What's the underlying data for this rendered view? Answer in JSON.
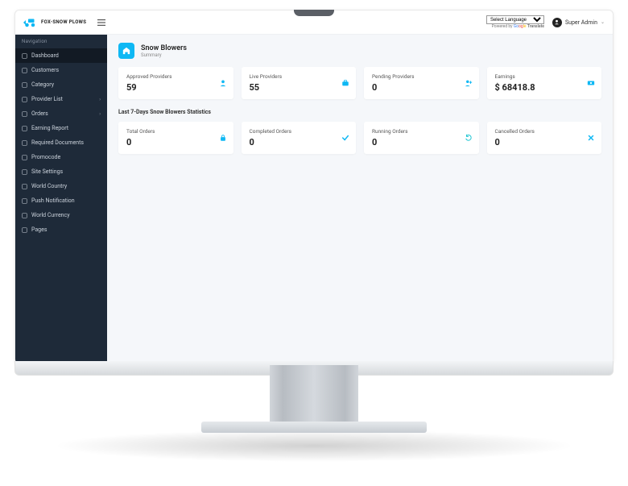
{
  "brand": {
    "name": "FOX-SNOW PLOWS"
  },
  "topbar": {
    "language_label": "Select Language",
    "powered_by": "Powered by",
    "google": "Google",
    "translate": "Translate",
    "user_name": "Super Admin"
  },
  "sidebar": {
    "header": "Navigation",
    "items": [
      {
        "label": "Dashboard",
        "active": true,
        "expandable": false
      },
      {
        "label": "Customers",
        "active": false,
        "expandable": false
      },
      {
        "label": "Category",
        "active": false,
        "expandable": false
      },
      {
        "label": "Provider List",
        "active": false,
        "expandable": true
      },
      {
        "label": "Orders",
        "active": false,
        "expandable": true
      },
      {
        "label": "Earning Report",
        "active": false,
        "expandable": false
      },
      {
        "label": "Required Documents",
        "active": false,
        "expandable": false
      },
      {
        "label": "Promocode",
        "active": false,
        "expandable": false
      },
      {
        "label": "Site Settings",
        "active": false,
        "expandable": false
      },
      {
        "label": "World Country",
        "active": false,
        "expandable": false
      },
      {
        "label": "Push Notification",
        "active": false,
        "expandable": false
      },
      {
        "label": "World Currency",
        "active": false,
        "expandable": false
      },
      {
        "label": "Pages",
        "active": false,
        "expandable": false
      }
    ]
  },
  "page": {
    "title": "Snow Blowers",
    "subtitle": "Summary",
    "section_title": "Last 7-Days Snow Blowers Statistics"
  },
  "stats_primary": [
    {
      "label": "Approved Providers",
      "value": "59",
      "icon": "user-icon",
      "color": "ic-blue"
    },
    {
      "label": "Live Providers",
      "value": "55",
      "icon": "briefcase-icon",
      "color": "ic-blue"
    },
    {
      "label": "Pending Providers",
      "value": "0",
      "icon": "user-add-icon",
      "color": "ic-blue"
    },
    {
      "label": "Earnings",
      "value": "$ 68418.8",
      "icon": "money-icon",
      "color": "ic-blue"
    }
  ],
  "stats_secondary": [
    {
      "label": "Total Orders",
      "value": "0",
      "icon": "bag-icon",
      "color": "ic-blue"
    },
    {
      "label": "Completed Orders",
      "value": "0",
      "icon": "check-icon",
      "color": "ic-blue"
    },
    {
      "label": "Running Orders",
      "value": "0",
      "icon": "refresh-icon",
      "color": "ic-teal"
    },
    {
      "label": "Cancelled Orders",
      "value": "0",
      "icon": "close-icon",
      "color": "ic-blue"
    }
  ],
  "icons": {
    "user-icon": "👤",
    "briefcase-icon": "💼",
    "user-add-icon": "👤+",
    "money-icon": "💵",
    "bag-icon": "🔒",
    "check-icon": "✓",
    "refresh-icon": "⟳",
    "close-icon": "✕"
  }
}
